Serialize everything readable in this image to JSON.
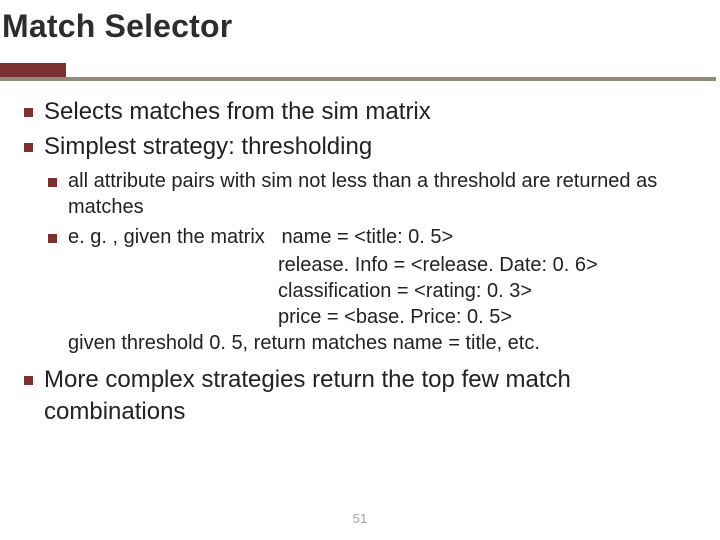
{
  "title": "Match Selector",
  "page_number": "51",
  "bullets": {
    "b1": "Selects matches from the sim matrix",
    "b2": "Simplest strategy: thresholding",
    "b2_1": "all attribute pairs with sim not less than a threshold are returned as matches",
    "b2_2_lead": "e. g. , given the matrix   ",
    "matrix": {
      "l1": "name = <title: 0. 5>",
      "l2": "release. Info = <release. Date: 0. 6>",
      "l3": "classification = <rating: 0. 3>",
      "l4": "price = <base. Price: 0. 5>"
    },
    "b2_2_tail": "given threshold 0. 5, return matches name = title, etc.",
    "b3": "More complex strategies return the top few match combinations"
  }
}
